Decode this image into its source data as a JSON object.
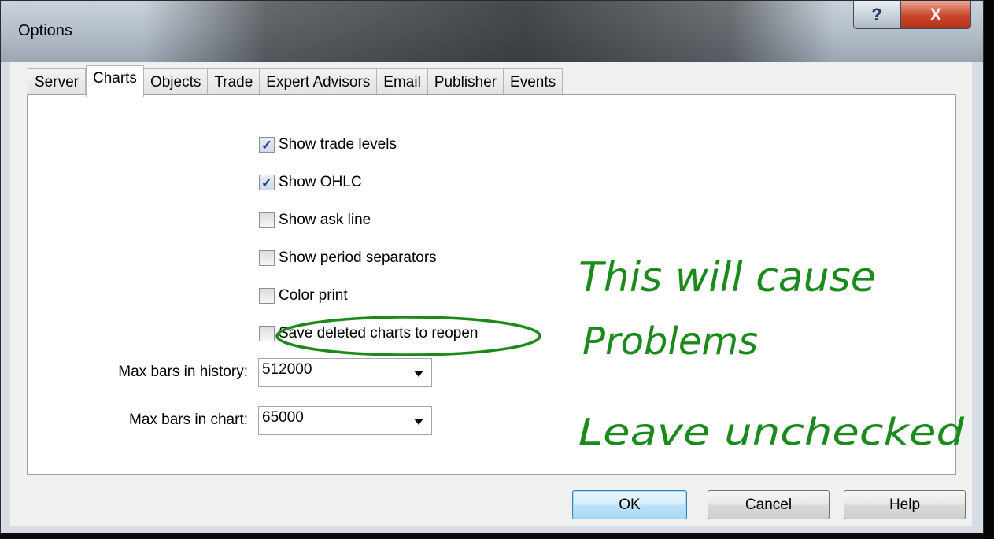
{
  "window": {
    "title": "Options",
    "help_glyph": "?",
    "close_glyph": "X"
  },
  "tabs": [
    "Server",
    "Charts",
    "Objects",
    "Trade",
    "Expert Advisors",
    "Email",
    "Publisher",
    "Events"
  ],
  "active_tab": "Charts",
  "checkboxes": [
    {
      "label": "Show trade levels",
      "checked": true
    },
    {
      "label": "Show OHLC",
      "checked": true
    },
    {
      "label": "Show ask line",
      "checked": false
    },
    {
      "label": "Show period separators",
      "checked": false
    },
    {
      "label": "Color print",
      "checked": false
    },
    {
      "label": "Save deleted charts to reopen",
      "checked": false
    }
  ],
  "fields": {
    "history_label": "Max bars in history:",
    "history_value": "512000",
    "chart_label": "Max bars in chart:",
    "chart_value": "65000"
  },
  "buttons": {
    "ok": "OK",
    "cancel": "Cancel",
    "help": "Help"
  },
  "annotation": {
    "line1": "This will cause",
    "line2": "Problems",
    "line3": "Leave unchecked",
    "color": "#1a8a1a"
  }
}
